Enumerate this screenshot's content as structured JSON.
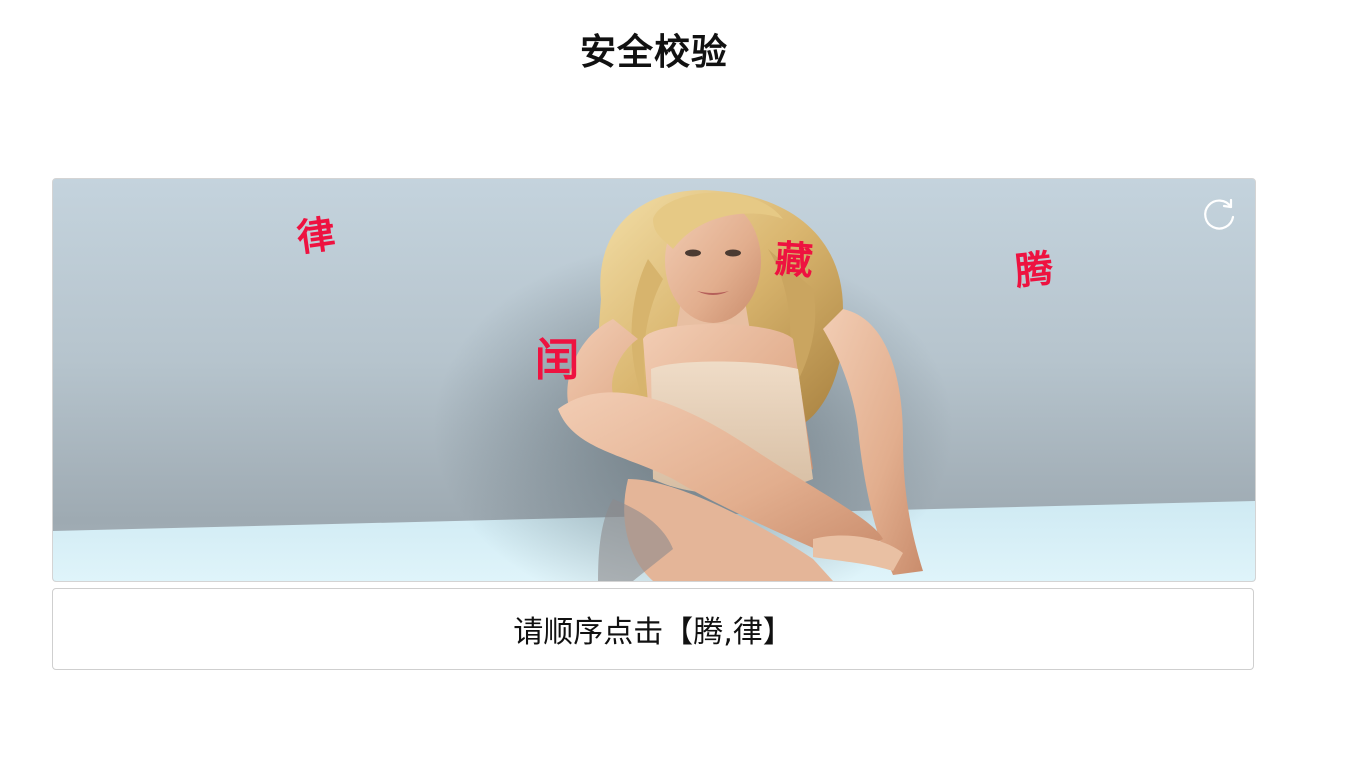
{
  "header": {
    "title": "安全校验"
  },
  "captcha": {
    "image_description": "photo",
    "characters": [
      "律",
      "藏",
      "腾",
      "闰"
    ],
    "char_color": "#ee1240",
    "refresh_icon": "refresh-icon"
  },
  "instruction": {
    "prefix": "请顺序点击",
    "open_bracket": "【",
    "targets": "腾,律",
    "close_bracket": "】"
  }
}
